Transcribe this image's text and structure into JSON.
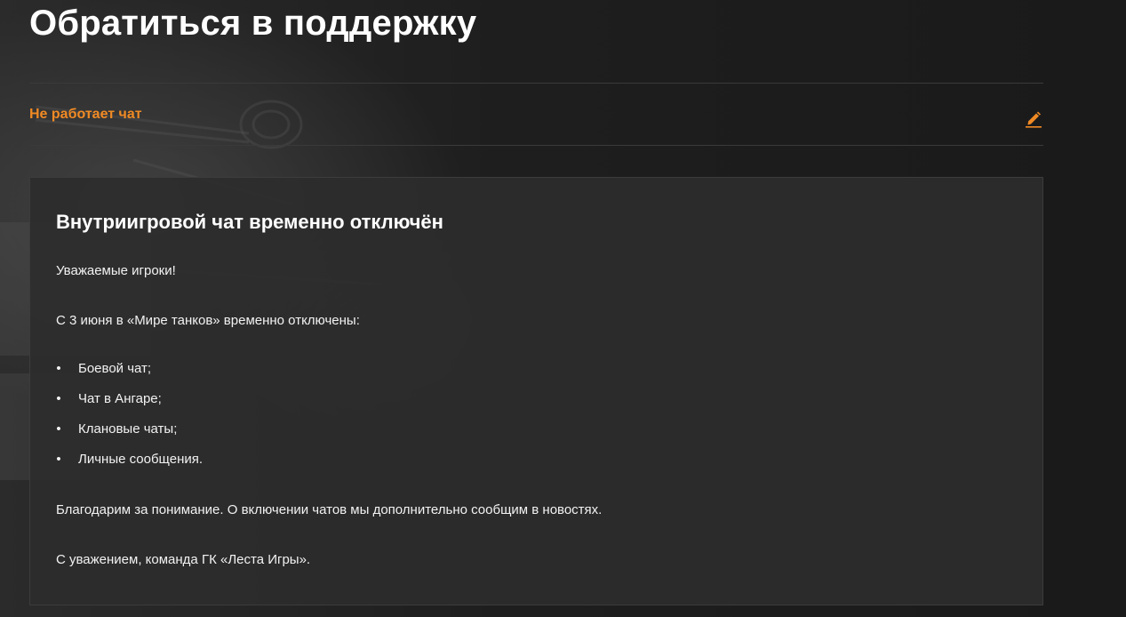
{
  "page": {
    "title": "Обратиться в поддержку"
  },
  "topic": {
    "label": "Не работает чат",
    "edit_icon": "pencil-icon",
    "accent_color": "#f08a24"
  },
  "article": {
    "title": "Внутриигровой чат временно отключён",
    "greeting": "Уважаемые игроки!",
    "intro": "С 3 июня в «Мире танков» временно отключены:",
    "list_items": [
      "Боевой чат;",
      "Чат в Ангаре;",
      "Клановые чаты;",
      "Личные сообщения."
    ],
    "bullet": "•",
    "thanks": "Благодарим за понимание. О включении чатов мы дополнительно сообщим в новостях.",
    "signature": "С уважением, команда ГК «Леста Игры»."
  }
}
